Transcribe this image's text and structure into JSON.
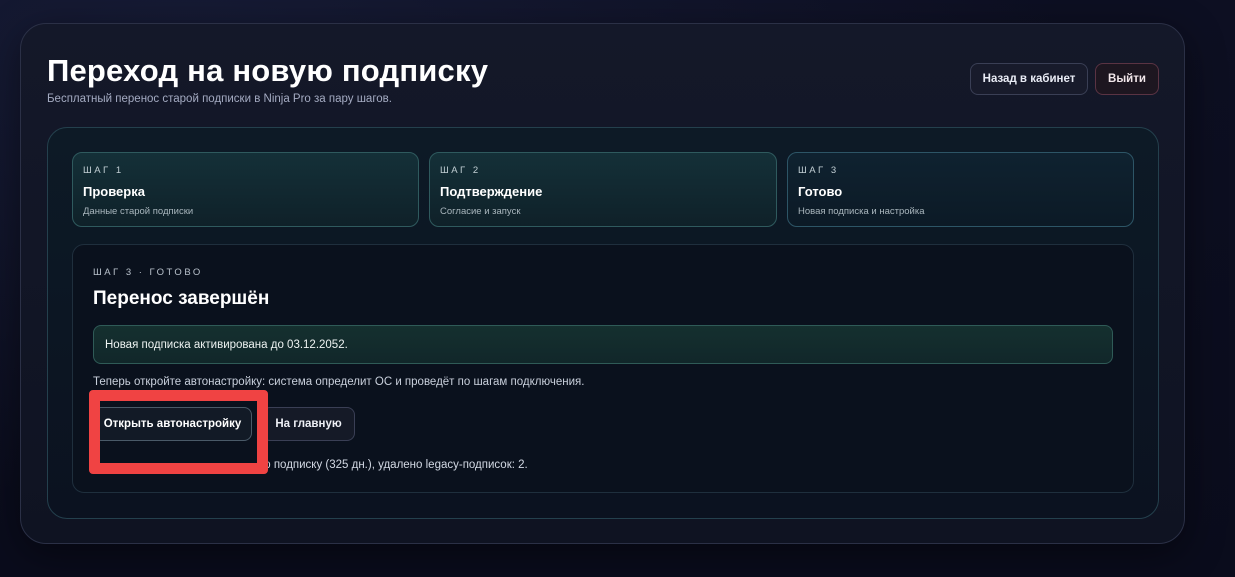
{
  "header": {
    "title": "Переход на новую подписку",
    "subtitle": "Бесплатный перенос старой подписки в Ninja Pro за пару шагов.",
    "back_label": "Назад в кабинет",
    "exit_label": "Выйти"
  },
  "steps": [
    {
      "num": "ШАГ 1",
      "title": "Проверка",
      "desc": "Данные старой подписки"
    },
    {
      "num": "ШАГ 2",
      "title": "Подтверждение",
      "desc": "Согласие и запуск"
    },
    {
      "num": "ШАГ 3",
      "title": "Готово",
      "desc": "Новая подписка и настройка"
    }
  ],
  "result_panel": {
    "crumb": "ШАГ 3 · ГОТОВО",
    "title": "Перенос завершён",
    "notice": "Новая подписка активирована до 03.12.2052.",
    "hint": "Теперь откройте автонастройку: система определит ОС и проведёт по шагам подключения.",
    "primary_button": "Открыть автонастройку",
    "secondary_button": "На главную",
    "result_text_visible": "ю подписку (325 дн.), удалено legacy-подписок: 2."
  },
  "colors": {
    "highlight": "#f04343",
    "background": "#0c0e1f",
    "accent_teal": "#2f5b57"
  }
}
